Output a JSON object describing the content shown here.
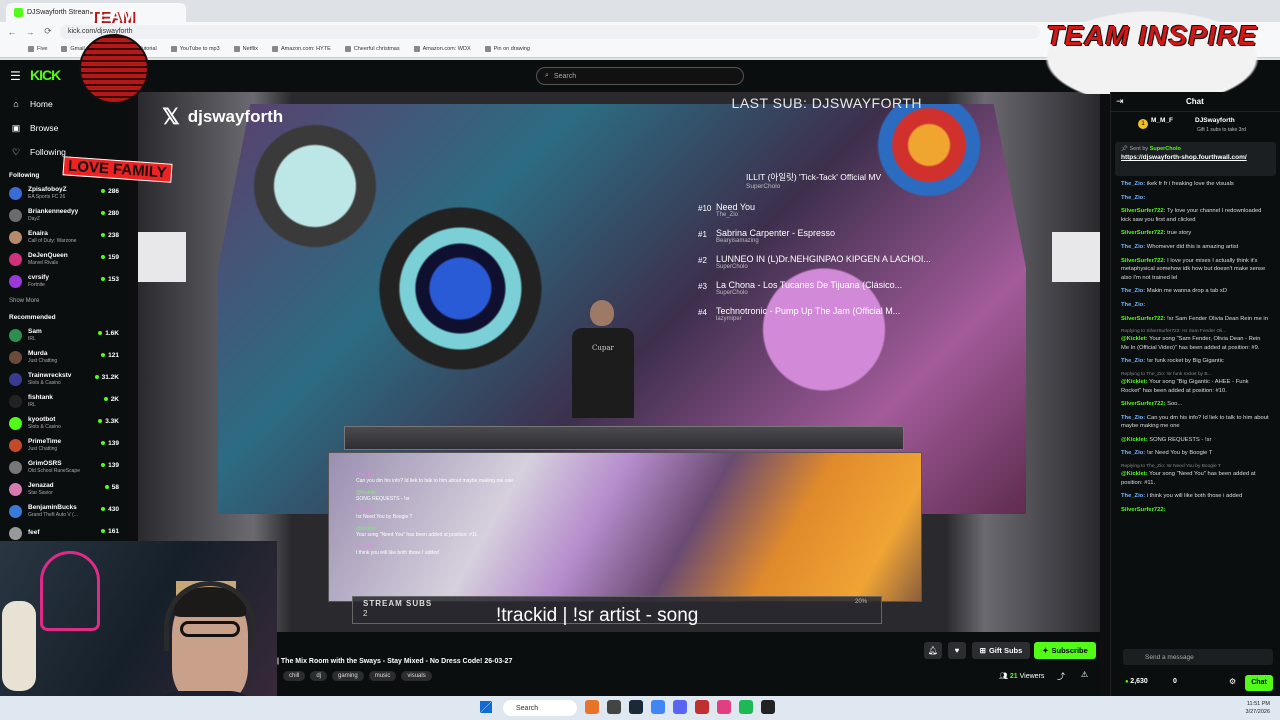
{
  "browser": {
    "tab_title": "DJSwayforth Stream",
    "url": "kick.com/djswayforth",
    "bookmarks": [
      "Five",
      "Gmail",
      "Sony Vegas Tutorial",
      "YouTube to mp3",
      "Netflix",
      "Amazon.com: HYTE",
      "Cheerful christmas",
      "Amazon.com: WDX",
      "Pin on drawing"
    ]
  },
  "kick": {
    "logo": "KICK",
    "search_placeholder": "Search"
  },
  "sidebar": {
    "nav": [
      {
        "label": "Home"
      },
      {
        "label": "Browse"
      },
      {
        "label": "Following"
      }
    ],
    "following_title": "Following",
    "following": [
      {
        "name": "ZpisafoboyZ",
        "game": "EA Sports FC 26",
        "viewers": "286",
        "color": "#3a6bd6"
      },
      {
        "name": "Briankenneedyy",
        "game": "DayZ",
        "viewers": "280",
        "color": "#6b6b6b"
      },
      {
        "name": "Enaira",
        "game": "Call of Duty: Warzone",
        "viewers": "238",
        "color": "#b58a6c"
      },
      {
        "name": "DeJenQueen",
        "game": "Marvel Rivals",
        "viewers": "159",
        "color": "#d0327a"
      },
      {
        "name": "cvrsify",
        "game": "Fortnite",
        "viewers": "153",
        "color": "#9a3ad6"
      }
    ],
    "show_more": "Show More",
    "recommended_title": "Recommended",
    "recommended": [
      {
        "name": "Sam",
        "game": "IRL",
        "viewers": "1.6K",
        "color": "#2e8f4c"
      },
      {
        "name": "Murda",
        "game": "Just Chatting",
        "viewers": "121",
        "color": "#6a4b3a"
      },
      {
        "name": "Trainwreckstv",
        "game": "Slots & Casino",
        "viewers": "31.2K",
        "color": "#3a3a8f"
      },
      {
        "name": "fishtank",
        "game": "IRL",
        "viewers": "2K",
        "color": "#222222"
      },
      {
        "name": "kyootbot",
        "game": "Slots & Casino",
        "viewers": "3.3K",
        "color": "#53fc18"
      },
      {
        "name": "PrimeTime",
        "game": "Just Chatting",
        "viewers": "139",
        "color": "#c04a2a"
      },
      {
        "name": "GrimOSRS",
        "game": "Old School RuneScape",
        "viewers": "139",
        "color": "#777777"
      },
      {
        "name": "Jenazad",
        "game": "Star Savior",
        "viewers": "58",
        "color": "#d67ab0"
      },
      {
        "name": "BenjaminBucks",
        "game": "Grand Theft Auto V (...",
        "viewers": "430",
        "color": "#3a7ad6"
      },
      {
        "name": "feef",
        "game": "",
        "viewers": "161",
        "color": "#999999"
      }
    ]
  },
  "overlay": {
    "globe_team": "TEAM",
    "globe_family": "LOVE FAMILY",
    "twitter_handle": "djswayforth",
    "team_logo": "TEAM INSPIRE",
    "last_sub": "LAST SUB: DJSWAYFORTH",
    "now_playing_title": "ILLIT (아일릿) 'Tick-Tack' Official MV",
    "now_playing_by": "SuperCholo",
    "queue": [
      {
        "num": "#10",
        "title": "Need You",
        "by": "The_Zio"
      },
      {
        "num": "#1",
        "title": "Sabrina Carpenter - Espresso",
        "by": "Bearyisamazing"
      },
      {
        "num": "#2",
        "title": "LUNNEO IN (L)Dr.NEHGINPAO KIPGEN A LACHOI...",
        "by": "SuperCholo"
      },
      {
        "num": "#3",
        "title": "La Chona - Los Tucanes De Tijuana (Clásico...",
        "by": "SuperCholo"
      },
      {
        "num": "#4",
        "title": "Technotronic - Pump Up The Jam (Official M...",
        "by": "lazymiper"
      }
    ],
    "shirt_text": "Cupar",
    "chat_overlay": [
      {
        "user": "The_Zio",
        "text": "Can you dm his info? Id liek to talk to him about maybe making me one",
        "kick": false
      },
      {
        "user": "@Kicklet",
        "text": "SONG REQUESTS - !sr",
        "kick": true
      },
      {
        "user": "The_Zio",
        "text": "!sr Need You by Boogie T",
        "kick": false
      },
      {
        "user": "@Kicklet",
        "text": "Your song \"Need You\" has been added at position: #11.",
        "kick": true
      },
      {
        "user": "The_Zio",
        "text": "I think you will like both those I added",
        "kick": false
      }
    ],
    "stream_subs_label": "STREAM SUBS",
    "stream_subs_count": "2",
    "stream_subs_pct": "20%",
    "trackid": "!trackid | !sr artist - song"
  },
  "stream": {
    "title": "| The Mix Room with the Sways - Stay Mixed - No Dress Code! 26-03-27",
    "tags": [
      "chill",
      "dj",
      "gaming",
      "music",
      "visuals"
    ],
    "gift_label": "Gift Subs",
    "subscribe_label": "Subscribe",
    "viewers_count": "21",
    "viewers_label": "Viewers"
  },
  "chat": {
    "title": "Chat",
    "gifter_rank": "1",
    "gifter_name": "M_M_F",
    "gifter_channel": "DJSwayforth",
    "gifter_note": "Gift 1 subs to take 3rd",
    "pinned_by_label": "Sent by",
    "pinned_by_user": "SuperCholo",
    "pinned_link": "https://djswayforth-shop.fourthwall.com/",
    "messages": [
      {
        "user": "The_Zio:",
        "text": "ikek fr fr i freaking love the visuals",
        "reply": "",
        "color": "blue"
      },
      {
        "user": "The_Zio:",
        "text": "",
        "reply": "",
        "color": "blue"
      },
      {
        "user": "SilverSurfer722:",
        "text": "Ty love your channel I redownloaded kick saw you first and clicked",
        "reply": "",
        "color": "green"
      },
      {
        "user": "SilverSurfer722:",
        "text": "true story",
        "reply": "",
        "color": "green"
      },
      {
        "user": "The_Zio:",
        "text": "Whomever did this is amazing artist",
        "reply": "",
        "color": "blue"
      },
      {
        "user": "SilverSurfer722:",
        "text": "I love your mixes I actually think it's metaphysical somehow idk how but doesn't make sense also I'm not trained lel",
        "reply": "",
        "color": "green"
      },
      {
        "user": "The_Zio:",
        "text": "Makin me wanna drop a tab xD",
        "reply": "",
        "color": "blue"
      },
      {
        "user": "The_Zio:",
        "text": "",
        "reply": "",
        "color": "blue"
      },
      {
        "user": "SilverSurfer722:",
        "text": "!sr Sam Fender Olivia Dean Rein me in",
        "reply": "",
        "color": "green"
      },
      {
        "user": "@Kicklet:",
        "text": "Your song \"Sam Fender, Olivia Dean - Rein Me In (Official Video)\" has been added at position: #9.",
        "reply": "Replying to SilverSurfer722: !sr Sam Fender Oli...",
        "color": "kick"
      },
      {
        "user": "The_Zio:",
        "text": "!sr funk rocket by Big Gigantic",
        "reply": "",
        "color": "blue"
      },
      {
        "user": "@Kicklet:",
        "text": "Your song \"Big Gigantic - AHEE - Funk Rocket\" has been added at position: #10.",
        "reply": "Replying to The_Zio: !sr funk rocket by B...",
        "color": "kick"
      },
      {
        "user": "SilverSurfer722:",
        "text": "Soo...",
        "reply": "",
        "color": "green"
      },
      {
        "user": "The_Zio:",
        "text": "Can you dm his info? Id liek to talk to him about maybe making me one",
        "reply": "",
        "color": "blue"
      },
      {
        "user": "@Kicklet:",
        "text": "SONG REQUESTS - !sr",
        "reply": "",
        "color": "kick"
      },
      {
        "user": "The_Zio:",
        "text": "!sr Need You by Boogie T",
        "reply": "",
        "color": "blue"
      },
      {
        "user": "@Kicklet:",
        "text": "Your song \"Need You\" has been added at position: #11.",
        "reply": "Replying to The_Zio: !sr Need You by Boogie T",
        "color": "kick"
      },
      {
        "user": "The_Zio:",
        "text": "i think you will like both those i added",
        "reply": "",
        "color": "blue"
      },
      {
        "user": "SilverSurfer722:",
        "text": "",
        "reply": "",
        "color": "green"
      }
    ],
    "input_placeholder": "Send a message",
    "points": "2,630",
    "bolt_count": "0",
    "send_label": "Chat"
  },
  "taskbar": {
    "search_label": "Search",
    "time": "11:51 PM",
    "date": "3/27/2026"
  }
}
